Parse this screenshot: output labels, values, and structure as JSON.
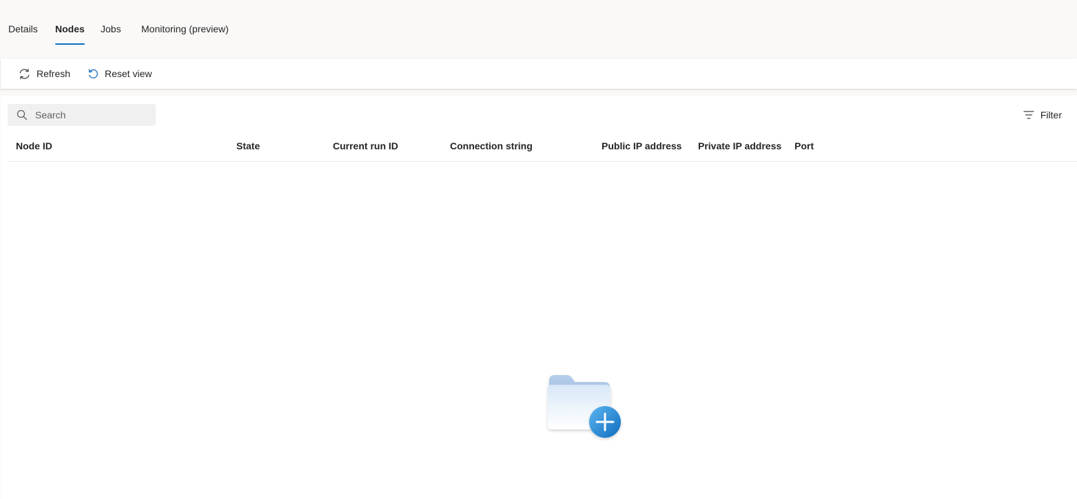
{
  "tabs": [
    {
      "label": "Details",
      "active": false
    },
    {
      "label": "Nodes",
      "active": true
    },
    {
      "label": "Jobs",
      "active": false
    },
    {
      "label": "Monitoring (preview)",
      "active": false
    }
  ],
  "toolbar": {
    "refresh_label": "Refresh",
    "reset_view_label": "Reset view"
  },
  "search": {
    "placeholder": "Search",
    "value": ""
  },
  "filter": {
    "label": "Filter"
  },
  "table": {
    "columns": [
      "Node ID",
      "State",
      "Current run ID",
      "Connection string",
      "Public IP address",
      "Private IP address",
      "Port"
    ],
    "rows": []
  },
  "icons": {
    "refresh": "refresh-icon",
    "reset_view": "reset-view-icon",
    "search": "search-icon",
    "filter": "filter-icon",
    "empty_state": "add-folder-icon"
  },
  "colors": {
    "accent": "#0f6cbd",
    "tab_background": "#faf9f8",
    "surface": "#ffffff",
    "search_background": "#f0f0f0"
  }
}
